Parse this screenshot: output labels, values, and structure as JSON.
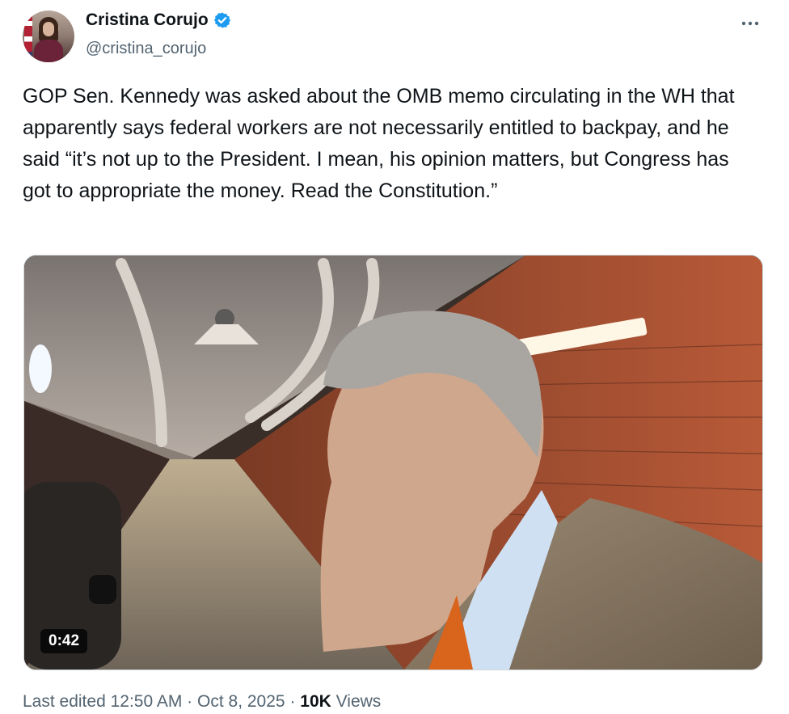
{
  "author": {
    "display_name": "Cristina Corujo",
    "handle": "@cristina_corujo",
    "verified": true,
    "verified_color": "#1d9bf0"
  },
  "tweet": {
    "text": "GOP Sen. Kennedy was asked about the OMB memo circulating in the WH that apparently says federal workers are not necessarily entitled to backpay, and he said “it’s not up to the President. I mean, his opinion matters, but Congress has got to appropriate the money. Read the Constitution.”"
  },
  "media": {
    "type": "video",
    "duration": "0:42"
  },
  "meta": {
    "edited_label": "Last edited",
    "time": "12:50 AM",
    "date": "Oct 8, 2025",
    "separator": "·",
    "views_count": "10K",
    "views_label": "Views"
  },
  "icons": {
    "more": "more-horizontal-icon",
    "verified": "verified-badge-icon"
  }
}
